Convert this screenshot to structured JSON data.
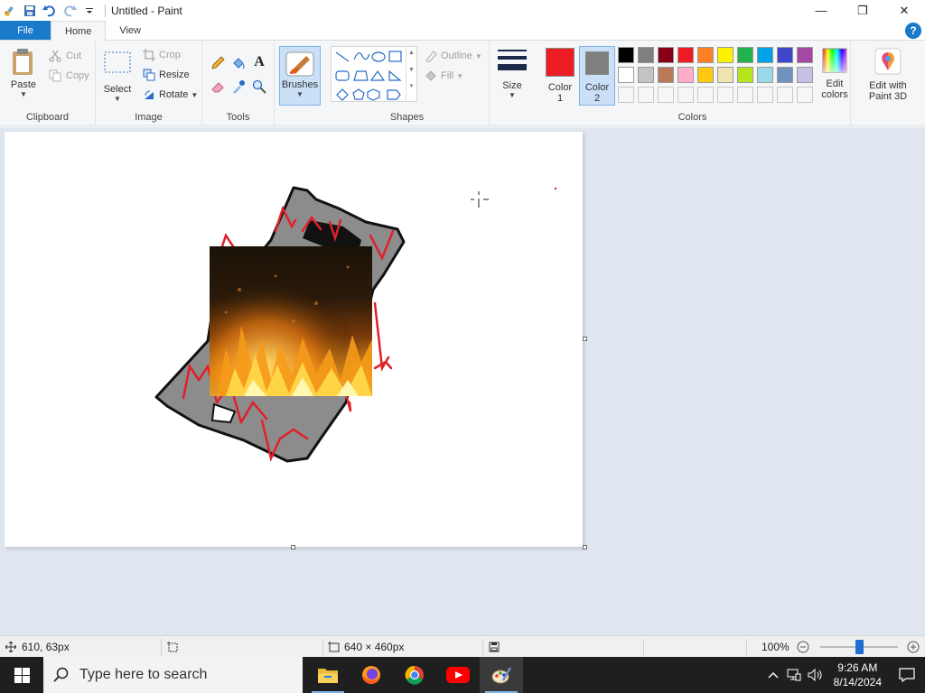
{
  "window": {
    "title": "Untitled - Paint",
    "minimize_glyph": "—",
    "restore_glyph": "❐",
    "close_glyph": "✕"
  },
  "tabs": {
    "file": "File",
    "home": "Home",
    "view": "View",
    "help": "?"
  },
  "ribbon": {
    "clipboard": {
      "paste": "Paste",
      "cut": "Cut",
      "copy": "Copy",
      "label": "Clipboard"
    },
    "image": {
      "select": "Select",
      "crop": "Crop",
      "resize": "Resize",
      "rotate": "Rotate",
      "label": "Image"
    },
    "tools": {
      "label": "Tools"
    },
    "brushes": {
      "label": "Brushes"
    },
    "shapes": {
      "outline": "Outline",
      "fill": "Fill",
      "label": "Shapes"
    },
    "size": {
      "label": "Size"
    },
    "color1": {
      "label_line1": "Color",
      "label_line2": "1",
      "value": "#ed1c24"
    },
    "color2": {
      "label_line1": "Color",
      "label_line2": "2",
      "value": "#7f7f7f"
    },
    "colors": {
      "label": "Colors",
      "row1": [
        "#000000",
        "#7f7f7f",
        "#880015",
        "#ed1c24",
        "#ff7f27",
        "#fff200",
        "#22b14c",
        "#00a2e8",
        "#3f48cc",
        "#a349a4"
      ],
      "row2": [
        "#ffffff",
        "#c3c3c3",
        "#b97a57",
        "#ffaec9",
        "#ffc90e",
        "#efe4b0",
        "#b5e61d",
        "#99d9ea",
        "#7092be",
        "#c8bfe7"
      ]
    },
    "edit_colors": {
      "line1": "Edit",
      "line2": "colors"
    },
    "paint3d": {
      "line1": "Edit with",
      "line2": "Paint 3D"
    }
  },
  "statusbar": {
    "cursor_pos": "610, 63px",
    "canvas_size": "640 × 460px",
    "zoom": "100%",
    "zoom_level": 0.5
  },
  "taskbar": {
    "search_placeholder": "Type here to search",
    "time": "9:26 AM",
    "date": "8/14/2024"
  }
}
